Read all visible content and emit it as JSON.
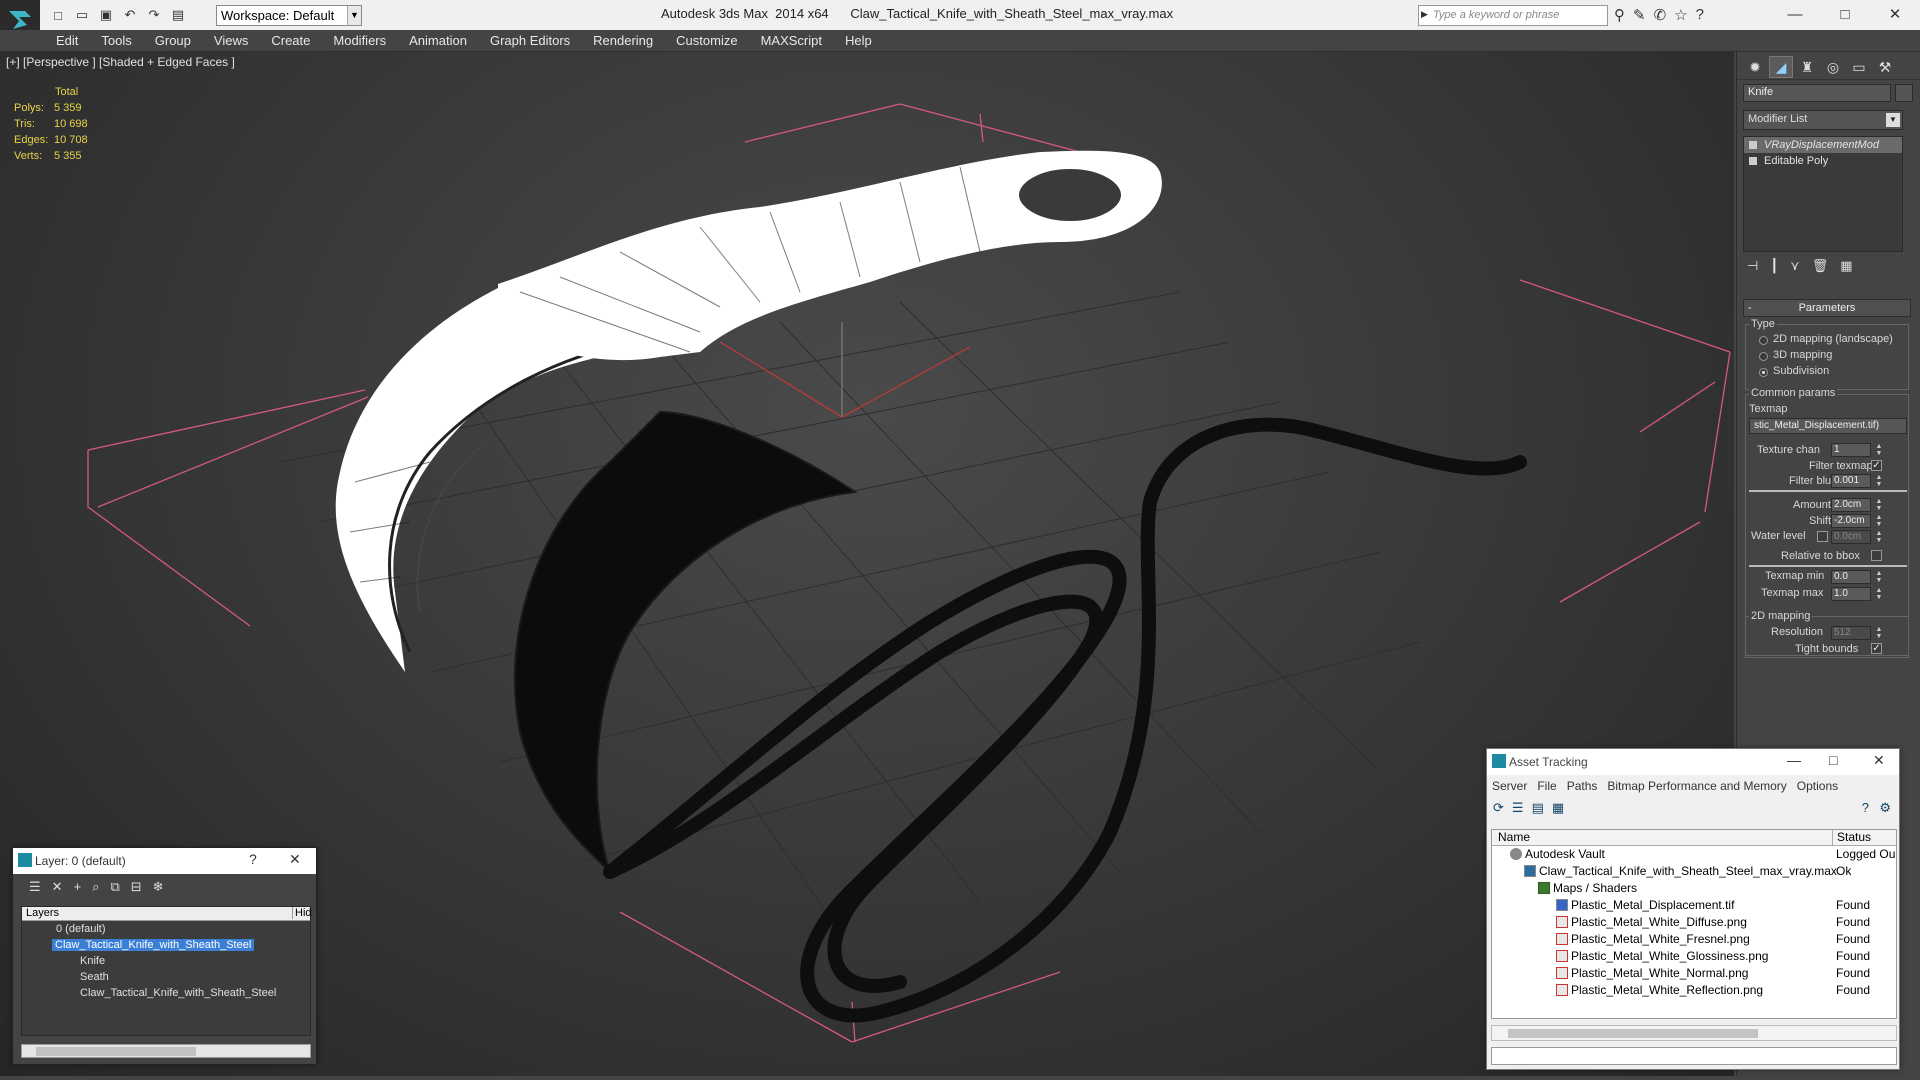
{
  "titlebar": {
    "workspace": "Workspace: Default",
    "app_name": "Autodesk 3ds Max  2014 x64",
    "file_name": "Claw_Tactical_Knife_with_Sheath_Steel_max_vray.max",
    "search_placeholder": "Type a keyword or phrase"
  },
  "menu": [
    "Edit",
    "Tools",
    "Group",
    "Views",
    "Create",
    "Modifiers",
    "Animation",
    "Graph Editors",
    "Rendering",
    "Customize",
    "MAXScript",
    "Help"
  ],
  "viewport": {
    "label": "[+] [Perspective ] [Shaded + Edged Faces ]",
    "stats": {
      "header": "Total",
      "polys_label": "Polys:",
      "polys": "5 359",
      "tris_label": "Tris:",
      "tris": "10 698",
      "edges_label": "Edges:",
      "edges": "10 708",
      "verts_label": "Verts:",
      "verts": "5 355"
    }
  },
  "command_panel": {
    "object_name": "Knife",
    "modifier_list": "Modifier List",
    "stack": [
      "VRayDisplacementMod",
      "Editable Poly"
    ],
    "parameters_title": "Parameters",
    "type_label": "Type",
    "type_options": [
      "2D mapping (landscape)",
      "3D mapping",
      "Subdivision"
    ],
    "type_selected": "Subdivision",
    "common_params": "Common params",
    "texmap_label": "Texmap",
    "texmap_value": "stic_Metal_Displacement.tif)",
    "texture_chan_label": "Texture chan",
    "texture_chan": "1",
    "filter_texmap_label": "Filter texmap",
    "filter_blur_label": "Filter blur",
    "filter_blur": "0.001",
    "amount_label": "Amount",
    "amount": "2.0cm",
    "shift_label": "Shift",
    "shift": "-2.0cm",
    "water_level_label": "Water level",
    "water_level": "0.0cm",
    "relative_bbox_label": "Relative to bbox",
    "texmap_min_label": "Texmap min",
    "texmap_min": "0.0",
    "texmap_max_label": "Texmap max",
    "texmap_max": "1.0",
    "mapping2d_label": "2D mapping",
    "resolution_label": "Resolution",
    "resolution": "512",
    "tight_bounds_label": "Tight bounds"
  },
  "layer_dialog": {
    "title": "Layer: 0 (default)",
    "col_layers": "Layers",
    "col_hide": "Hid",
    "rows": [
      {
        "name": "0 (default)",
        "indent": 0
      },
      {
        "name": "Claw_Tactical_Knife_with_Sheath_Steel",
        "indent": 0,
        "selected": true
      },
      {
        "name": "Knife",
        "indent": 1
      },
      {
        "name": "Seath",
        "indent": 1
      },
      {
        "name": "Claw_Tactical_Knife_with_Sheath_Steel",
        "indent": 1
      }
    ]
  },
  "asset_dialog": {
    "title": "Asset Tracking",
    "menu": [
      "Server",
      "File",
      "Paths",
      "Bitmap Performance and Memory",
      "Options"
    ],
    "col_name": "Name",
    "col_status": "Status",
    "rows": [
      {
        "name": "Autodesk Vault",
        "status": "Logged Ou",
        "icon": "vault"
      },
      {
        "name": "Claw_Tactical_Knife_with_Sheath_Steel_max_vray.max",
        "status": "Ok",
        "icon": "max"
      },
      {
        "name": "Maps / Shaders",
        "status": "",
        "icon": "fold"
      },
      {
        "name": "Plastic_Metal_Displacement.tif",
        "status": "Found",
        "icon": "tif"
      },
      {
        "name": "Plastic_Metal_White_Diffuse.png",
        "status": "Found",
        "icon": "png"
      },
      {
        "name": "Plastic_Metal_White_Fresnel.png",
        "status": "Found",
        "icon": "png"
      },
      {
        "name": "Plastic_Metal_White_Glossiness.png",
        "status": "Found",
        "icon": "png"
      },
      {
        "name": "Plastic_Metal_White_Normal.png",
        "status": "Found",
        "icon": "png"
      },
      {
        "name": "Plastic_Metal_White_Reflection.png",
        "status": "Found",
        "icon": "png"
      }
    ]
  },
  "colors": {
    "viewport_bg": "#3a3a3a",
    "stats_text": "#e8d44a",
    "selection_blue": "#3b7fd4",
    "bbox_pink": "#d45a7a"
  }
}
